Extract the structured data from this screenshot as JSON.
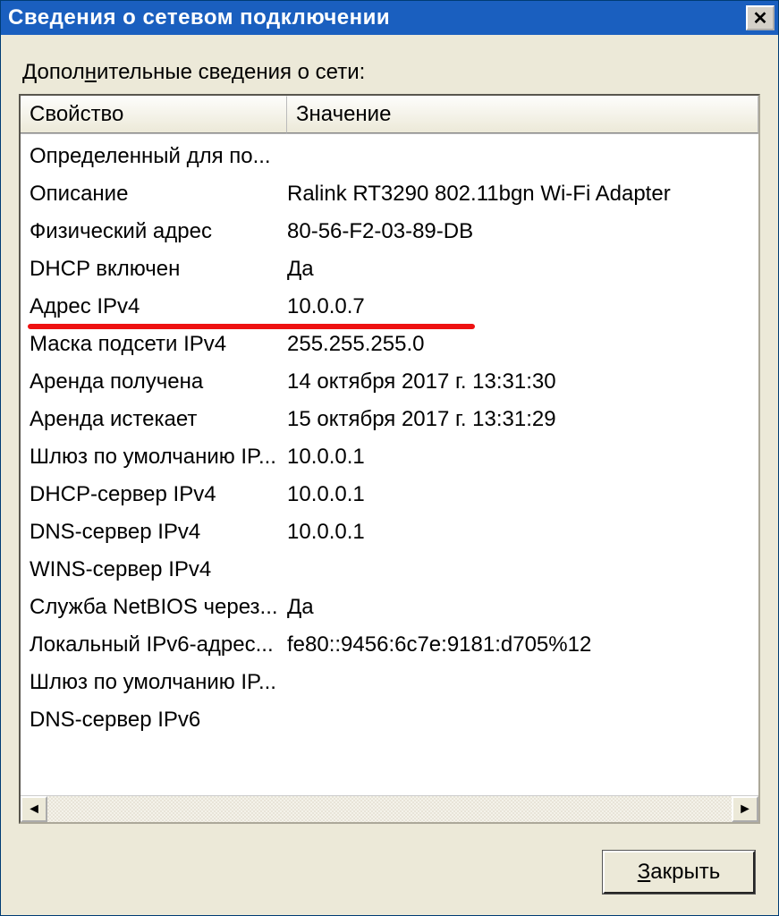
{
  "window": {
    "title": "Сведения о сетевом подключении"
  },
  "label": {
    "before": "Допол",
    "mnemonic": "н",
    "after": "ительные сведения о сети:"
  },
  "columns": {
    "property": "Свойство",
    "value": "Значение"
  },
  "rows": [
    {
      "prop": "Определенный для по...",
      "val": ""
    },
    {
      "prop": "Описание",
      "val": "Ralink RT3290 802.11bgn Wi-Fi Adapter"
    },
    {
      "prop": "Физический адрес",
      "val": "80-56-F2-03-89-DB"
    },
    {
      "prop": "DHCP включен",
      "val": "Да"
    },
    {
      "prop": "Адрес IPv4",
      "val": "10.0.0.7"
    },
    {
      "prop": "Маска подсети IPv4",
      "val": "255.255.255.0"
    },
    {
      "prop": "Аренда получена",
      "val": "14 октября 2017 г. 13:31:30"
    },
    {
      "prop": "Аренда истекает",
      "val": "15 октября 2017 г. 13:31:29"
    },
    {
      "prop": "Шлюз по умолчанию IP...",
      "val": "10.0.0.1"
    },
    {
      "prop": "DHCP-сервер IPv4",
      "val": "10.0.0.1"
    },
    {
      "prop": "DNS-сервер IPv4",
      "val": "10.0.0.1"
    },
    {
      "prop": "WINS-сервер IPv4",
      "val": ""
    },
    {
      "prop": "Служба NetBIOS через...",
      "val": "Да"
    },
    {
      "prop": "Локальный IPv6-адрес...",
      "val": "fe80::9456:6c7e:9181:d705%12"
    },
    {
      "prop": "Шлюз по умолчанию IP...",
      "val": ""
    },
    {
      "prop": "DNS-сервер IPv6",
      "val": ""
    }
  ],
  "buttons": {
    "close_before": "",
    "close_mnemonic": "З",
    "close_after": "акрыть"
  },
  "annotation": {
    "highlight_row_index": 4
  }
}
